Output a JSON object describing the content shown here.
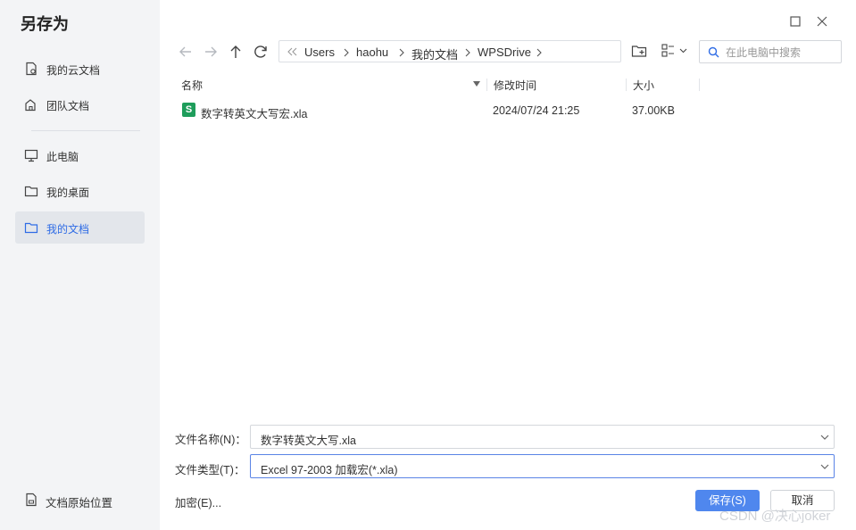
{
  "dialog": {
    "title": "另存为"
  },
  "sidebar": {
    "items": [
      {
        "label": "我的云文档",
        "icon": "cloud-doc-icon"
      },
      {
        "label": "团队文档",
        "icon": "team-doc-icon"
      },
      {
        "label": "此电脑",
        "icon": "monitor-icon"
      },
      {
        "label": "我的桌面",
        "icon": "folder-icon"
      },
      {
        "label": "我的文档",
        "icon": "folder-icon",
        "active": true
      }
    ],
    "original_location": "文档原始位置"
  },
  "breadcrumb": {
    "items": [
      "Users",
      "haohu",
      "我的文档",
      "WPSDrive"
    ]
  },
  "search": {
    "placeholder": "在此电脑中搜索"
  },
  "file_list": {
    "columns": {
      "name": "名称",
      "modified": "修改时间",
      "size": "大小"
    },
    "rows": [
      {
        "icon_text": "S",
        "name": "数字转英文大写宏.xla",
        "modified": "2024/07/24 21:25",
        "size": "37.00KB"
      }
    ]
  },
  "form": {
    "filename_label": "文件名称(N)：",
    "filename_value": "数字转英文大写.xla",
    "filetype_label": "文件类型(T)：",
    "filetype_value": "Excel 97-2003 加载宏(*.xla)",
    "encrypt_label": "加密(E)..."
  },
  "buttons": {
    "save": "保存(S)",
    "cancel": "取消"
  },
  "watermark": "CSDN @决心joker",
  "colors": {
    "accent": "#4f87ee",
    "active_text": "#2f6ce5",
    "sidebar_bg": "#f3f4f6",
    "excel_green": "#1e9d5b"
  }
}
